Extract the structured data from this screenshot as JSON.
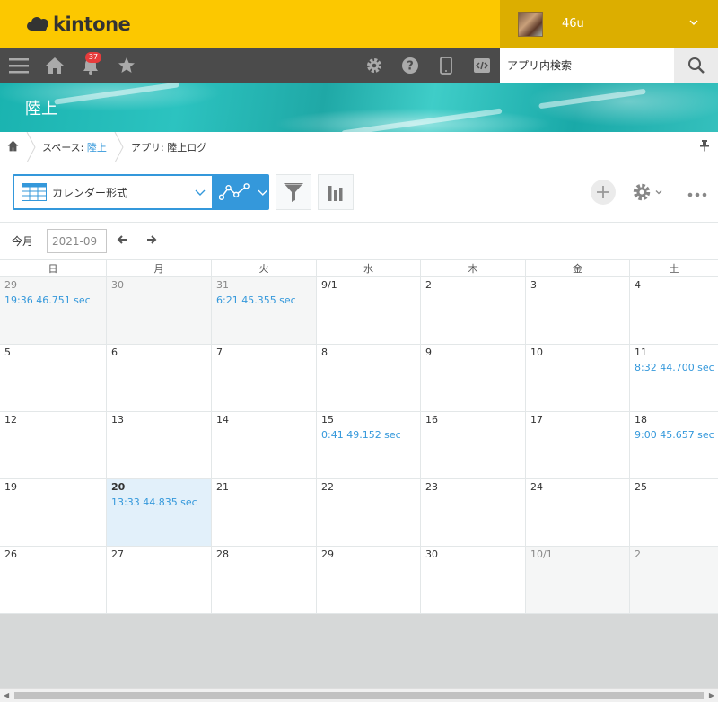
{
  "header": {
    "logo_text": "kintone",
    "user_name": "46u"
  },
  "navbar": {
    "notification_count": "37",
    "search_placeholder": "アプリ内検索"
  },
  "banner": {
    "title": "陸上"
  },
  "breadcrumb": {
    "space_prefix": "スペース: ",
    "space_name": "陸上",
    "app_prefix": "アプリ: ",
    "app_name": "陸上ログ"
  },
  "toolbar": {
    "view_label": "カレンダー形式"
  },
  "calendar_nav": {
    "today_label": "今月",
    "month_value": "2021-09"
  },
  "calendar": {
    "weekdays": [
      "日",
      "月",
      "火",
      "水",
      "木",
      "金",
      "土"
    ],
    "weeks": [
      [
        {
          "day": "29",
          "other": true,
          "event": "19:36 46.751 sec"
        },
        {
          "day": "30",
          "other": true,
          "event": ""
        },
        {
          "day": "31",
          "other": true,
          "event": "6:21 45.355 sec"
        },
        {
          "day": "9/1",
          "other": false,
          "event": ""
        },
        {
          "day": "2",
          "other": false,
          "event": ""
        },
        {
          "day": "3",
          "other": false,
          "event": ""
        },
        {
          "day": "4",
          "other": false,
          "event": ""
        }
      ],
      [
        {
          "day": "5",
          "other": false,
          "event": ""
        },
        {
          "day": "6",
          "other": false,
          "event": ""
        },
        {
          "day": "7",
          "other": false,
          "event": ""
        },
        {
          "day": "8",
          "other": false,
          "event": ""
        },
        {
          "day": "9",
          "other": false,
          "event": ""
        },
        {
          "day": "10",
          "other": false,
          "event": ""
        },
        {
          "day": "11",
          "other": false,
          "event": "8:32 44.700 sec"
        }
      ],
      [
        {
          "day": "12",
          "other": false,
          "event": ""
        },
        {
          "day": "13",
          "other": false,
          "event": ""
        },
        {
          "day": "14",
          "other": false,
          "event": ""
        },
        {
          "day": "15",
          "other": false,
          "event": "0:41 49.152 sec"
        },
        {
          "day": "16",
          "other": false,
          "event": ""
        },
        {
          "day": "17",
          "other": false,
          "event": ""
        },
        {
          "day": "18",
          "other": false,
          "event": "9:00 45.657 sec"
        }
      ],
      [
        {
          "day": "19",
          "other": false,
          "event": ""
        },
        {
          "day": "20",
          "other": false,
          "today": true,
          "event": "13:33 44.835 sec"
        },
        {
          "day": "21",
          "other": false,
          "event": ""
        },
        {
          "day": "22",
          "other": false,
          "event": ""
        },
        {
          "day": "23",
          "other": false,
          "event": ""
        },
        {
          "day": "24",
          "other": false,
          "event": ""
        },
        {
          "day": "25",
          "other": false,
          "event": ""
        }
      ],
      [
        {
          "day": "26",
          "other": false,
          "event": ""
        },
        {
          "day": "27",
          "other": false,
          "event": ""
        },
        {
          "day": "28",
          "other": false,
          "event": ""
        },
        {
          "day": "29",
          "other": false,
          "event": ""
        },
        {
          "day": "30",
          "other": false,
          "event": ""
        },
        {
          "day": "10/1",
          "other": true,
          "event": ""
        },
        {
          "day": "2",
          "other": true,
          "event": ""
        }
      ]
    ]
  },
  "colors": {
    "header_yellow": "#fcc800",
    "user_area": "#dcae00",
    "navbar": "#4b4b4b",
    "accent_blue": "#3498db",
    "today_bg": "#e2f0fa"
  }
}
